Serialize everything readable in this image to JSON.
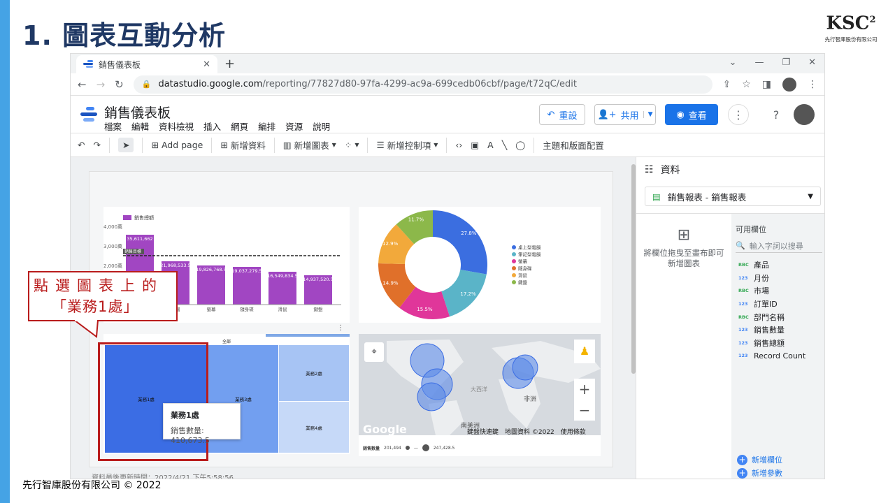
{
  "slide": {
    "title": "1. 圖表互動分析",
    "logo": "KSC",
    "logo_sup": "2",
    "logo_sub": "先行智庫股份有限公司",
    "footer": "先行智庫股份有限公司 © 2022"
  },
  "browser": {
    "tab_title": "銷售儀表板",
    "url_host": "datastudio.google.com",
    "url_path": "/reporting/77827d80-97fa-4299-ac9a-699cedb06cbf/page/t72qC/edit"
  },
  "app": {
    "title": "銷售儀表板",
    "menu": [
      "檔案",
      "編輯",
      "資料檢視",
      "插入",
      "網頁",
      "編排",
      "資源",
      "說明"
    ],
    "reset": "重設",
    "share": "共用",
    "view": "查看"
  },
  "toolbar": {
    "add_page": "Add page",
    "add_data": "新增資料",
    "add_chart": "新增圖表",
    "add_control": "新增控制項",
    "theme": "主題和版面配置"
  },
  "panel": {
    "title": "資料",
    "source": "銷售報表 - 銷售報表",
    "drop_hint": "將欄位拖曳至畫布即可新增圖表",
    "fields_header": "可用欄位",
    "search_placeholder": "輸入字詞以搜尋",
    "fields": [
      {
        "type": "RBC",
        "name": "產品"
      },
      {
        "type": "123",
        "name": "月份"
      },
      {
        "type": "RBC",
        "name": "市場"
      },
      {
        "type": "123",
        "name": "訂單ID"
      },
      {
        "type": "RBC",
        "name": "部門名稱"
      },
      {
        "type": "123",
        "name": "銷售數量"
      },
      {
        "type": "123",
        "name": "銷售總額"
      },
      {
        "type": "123",
        "name": "Record Count"
      }
    ],
    "add_field": "新增欄位",
    "add_param": "新增參數"
  },
  "bar": {
    "legend": "銷售總額",
    "yticks": [
      "4,000萬",
      "3,000萬",
      "2,000萬"
    ],
    "target_label": "銷售目標",
    "labels": [
      "35,611,662",
      "21,968,533.5",
      "19,826,768.5",
      "19,037,279.5",
      "16,549,834.5",
      "14,937,520.5"
    ],
    "cats": [
      "",
      "電腦",
      "螢幕",
      "隨身碟",
      "滑鼠",
      "鍵盤"
    ]
  },
  "pie": {
    "labels": [
      "27.8%",
      "17.2%",
      "15.5%",
      "14.9%",
      "12.9%",
      "11.7%"
    ],
    "legend": [
      "桌上型電腦",
      "筆記型電腦",
      "螢幕",
      "隨身碟",
      "滑鼠",
      "鍵盤"
    ],
    "colors": [
      "#3b6ee0",
      "#5ab4c8",
      "#e0369a",
      "#e0702a",
      "#f2a93b",
      "#8cb84a"
    ]
  },
  "treemap": {
    "all": "全部",
    "cells": [
      "業務1處",
      "業務3處",
      "業務2處",
      "業務4處"
    ]
  },
  "tooltip": {
    "title": "業務1處",
    "value": "銷售數量: 410,673.5"
  },
  "map": {
    "labels": [
      "非洲",
      "南美洲",
      "大西洋"
    ],
    "google": "Google",
    "attribution": "鍵盤快速鍵　地圖資料 ©2022　使用條款",
    "legend_title": "銷售數量",
    "legend_min": "201,494",
    "legend_max": "247,428.5"
  },
  "status": "資料最後更新時間：2022/4/21 下午5:58:56",
  "callout": {
    "line1": "點選圖表上的",
    "line2": "「業務1處」"
  }
}
